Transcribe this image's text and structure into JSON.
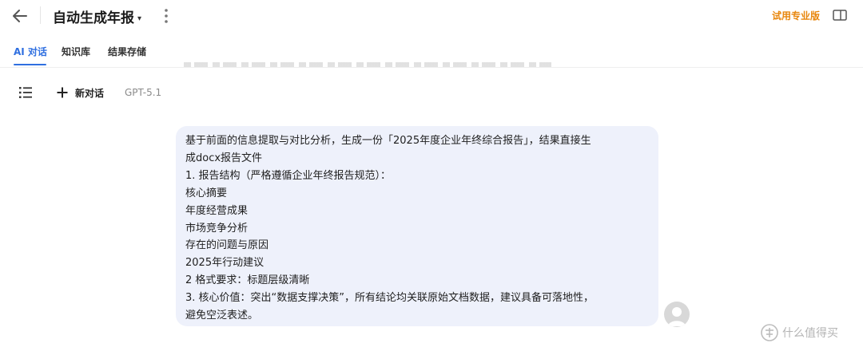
{
  "header": {
    "title": "自动生成年报",
    "title_caret": "▾",
    "pro_label": "试用专业版"
  },
  "tabs": [
    {
      "label": "AI 对话",
      "active": true
    },
    {
      "label": "知识库",
      "active": false
    },
    {
      "label": "结果存储",
      "active": false
    }
  ],
  "toolbar": {
    "new_chat_label": "新对话",
    "model": "GPT-5.1"
  },
  "message": {
    "role": "user",
    "lines": [
      "基于前面的信息提取与对比分析，生成一份「2025年度企业年终综合报告」，结果直接生",
      "成docx报告文件",
      "1. 报告结构（严格遵循企业年终报告规范）：",
      "核心摘要",
      "年度经营成果",
      "市场竞争分析",
      "存在的问题与原因",
      "2025年行动建议",
      "2 格式要求：标题层级清晰",
      "3. 核心价值：突出“数据支撑决策”，所有结论均关联原始文档数据，建议具备可落地性，",
      "避免空泛表述。"
    ]
  },
  "watermark": {
    "text": "什么值得买"
  },
  "colors": {
    "accent": "#2f6fe0",
    "pro": "#e8860c",
    "bubble_bg": "#eef1fb"
  },
  "icons": {
    "back": "arrow-left-icon",
    "more": "more-vertical-icon",
    "panel": "sidebar-panel-icon",
    "history": "list-icon",
    "new_chat": "plus-icon",
    "avatar": "user-avatar-icon"
  }
}
